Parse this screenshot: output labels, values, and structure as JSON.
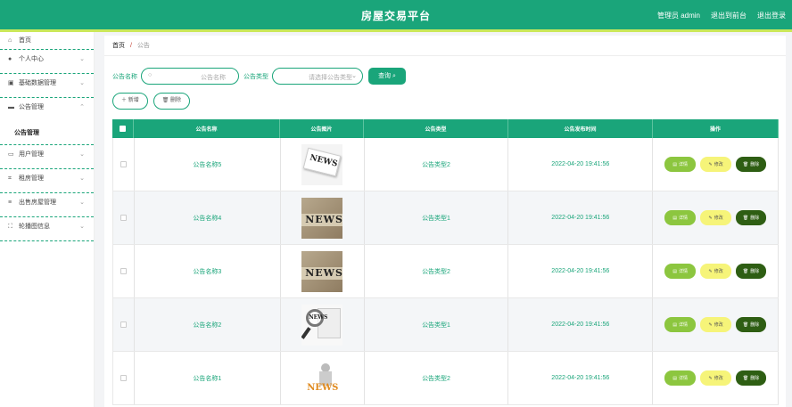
{
  "header": {
    "title": "房屋交易平台",
    "user": "管理员 admin",
    "back_to_admin": "退出到前台",
    "logout": "退出登录"
  },
  "sidebar": {
    "items": [
      {
        "label": "首页",
        "icon": "home-icon"
      },
      {
        "label": "个人中心",
        "icon": "user-icon"
      },
      {
        "label": "基础数据管理",
        "icon": "data-icon"
      },
      {
        "label": "公告管理",
        "icon": "monitor-icon"
      },
      {
        "label": "用户管理",
        "icon": "folder-icon"
      },
      {
        "label": "租房管理",
        "icon": "crop-icon"
      },
      {
        "label": "出售房屋管理",
        "icon": "list-icon"
      },
      {
        "label": "轮播图信息",
        "icon": "fullscreen-icon"
      }
    ],
    "sub_active": "公告管理"
  },
  "breadcrumb": {
    "home": "首页",
    "sep": "/",
    "current": "公告"
  },
  "search": {
    "name_label": "公告名称",
    "name_placeholder": "公告名称",
    "type_label": "公告类型",
    "type_placeholder": "请选择公告类型",
    "button": "查询"
  },
  "actions": {
    "add": "新增",
    "delete": "删除"
  },
  "table": {
    "headers": [
      "公告名称",
      "公告图片",
      "公告类型",
      "公告发布时间",
      "操作"
    ],
    "rows": [
      {
        "name": "公告名称5",
        "type": "公告类型2",
        "time": "2022-04-20 19:41:56",
        "image": "news-paper"
      },
      {
        "name": "公告名称4",
        "type": "公告类型1",
        "time": "2022-04-20 19:41:56",
        "image": "news-wood"
      },
      {
        "name": "公告名称3",
        "type": "公告类型2",
        "time": "2022-04-20 19:41:56",
        "image": "news-wood"
      },
      {
        "name": "公告名称2",
        "type": "公告类型1",
        "time": "2022-04-20 19:41:56",
        "image": "news-glass"
      },
      {
        "name": "公告名称1",
        "type": "公告类型2",
        "time": "2022-04-20 19:41:56",
        "image": "news-3d"
      }
    ],
    "ops": {
      "detail": "详情",
      "edit": "修改",
      "delete": "删除"
    }
  },
  "image_text": "NEWS",
  "colors": {
    "primary": "#1aa57a",
    "accent_bar": "#cbe85a",
    "detail": "#8cc63f",
    "edit": "#f6f479",
    "delete": "#2e5e13"
  }
}
